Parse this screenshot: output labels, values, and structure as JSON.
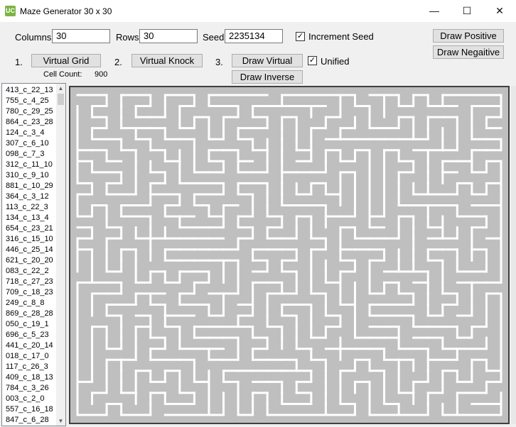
{
  "window": {
    "title": "Maze Generator 30 x 30",
    "app_icon_text": "UC",
    "minimize_glyph": "—",
    "maximize_glyph": "☐",
    "close_glyph": "✕"
  },
  "controls": {
    "columns_label": "Columns",
    "columns_value": "30",
    "rows_label": "Rows",
    "rows_value": "30",
    "seed_label": "Seed",
    "seed_value": "2235134",
    "increment_seed_label": "Increment Seed",
    "increment_seed_checked": true,
    "draw_positive": "Draw Positive",
    "draw_negative": "Draw Negaitive",
    "step1": "1.",
    "virtual_grid": "Virtual Grid",
    "step2": "2.",
    "virtual_knock": "Virtual Knock",
    "step3": "3.",
    "draw_virtual": "Draw Virtual",
    "unified_label": "Unified",
    "unified_checked": true,
    "draw_inverse": "Draw Inverse",
    "cell_count_label": "Cell Count:",
    "cell_count_value": "900"
  },
  "list": {
    "items": [
      "413_c_22_13",
      "755_c_4_25",
      "780_c_29_25",
      "864_c_23_28",
      "124_c_3_4",
      "307_c_6_10",
      "098_c_7_3",
      "312_c_11_10",
      "310_c_9_10",
      "881_c_10_29",
      "364_c_3_12",
      "113_c_22_3",
      "134_c_13_4",
      "654_c_23_21",
      "316_c_15_10",
      "446_c_25_14",
      "621_c_20_20",
      "083_c_22_2",
      "718_c_27_23",
      "709_c_18_23",
      "249_c_8_8",
      "869_c_28_28",
      "050_c_19_1",
      "696_c_5_23",
      "441_c_20_14",
      "018_c_17_0",
      "117_c_26_3",
      "409_c_18_13",
      "784_c_3_26",
      "003_c_2_0",
      "557_c_16_18",
      "847_c_6_28"
    ],
    "scroll_up_glyph": "▲",
    "scroll_down_glyph": "▼"
  },
  "maze": {
    "columns": 30,
    "rows": 30,
    "seed": 2235134,
    "background_color": "#bfbfbf",
    "passage_color": "#ffffff"
  }
}
